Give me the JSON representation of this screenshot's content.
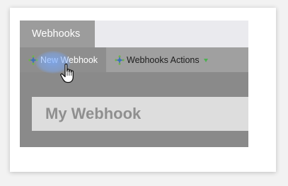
{
  "tabs": {
    "active_label": "Webhooks"
  },
  "toolbar": {
    "new_label": "New Webhook",
    "actions_label": "Webhooks Actions",
    "icon": "webhook-icon",
    "caret_color": "#4caf50"
  },
  "page": {
    "title": "My Webhook"
  },
  "cursor": "hand-pointer-icon"
}
